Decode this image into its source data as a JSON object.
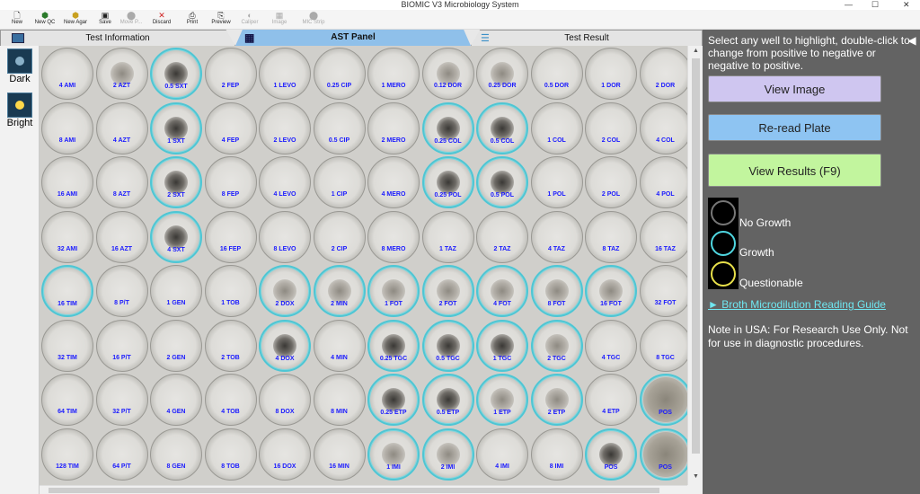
{
  "app": {
    "title": "BIOMIC V3 Microbiology System"
  },
  "window_controls": {
    "minimize": "—",
    "maximize": "☐",
    "close": "✕"
  },
  "toolbar": [
    {
      "label": "New",
      "icon": "new-icon",
      "enabled": true
    },
    {
      "label": "New QC",
      "icon": "new-qc-icon",
      "enabled": true
    },
    {
      "label": "New Agar",
      "icon": "new-agar-icon",
      "enabled": true
    },
    {
      "label": "Save",
      "icon": "save-icon",
      "enabled": true
    },
    {
      "label": "Move P...",
      "icon": "move-icon",
      "enabled": false
    },
    {
      "label": "Discard",
      "icon": "discard-icon",
      "enabled": true
    },
    {
      "label": "Print",
      "icon": "print-icon",
      "enabled": true
    },
    {
      "label": "Preview",
      "icon": "preview-icon",
      "enabled": true
    },
    {
      "label": "Caliper",
      "icon": "caliper-icon",
      "enabled": false
    },
    {
      "label": "Image",
      "icon": "image-icon",
      "enabled": false
    },
    {
      "label": "MIC Strip",
      "icon": "mic-strip-icon",
      "enabled": false
    }
  ],
  "tabs": [
    {
      "label": "Test Information",
      "active": false
    },
    {
      "label": "AST Panel",
      "active": true
    },
    {
      "label": "Test Result",
      "active": false
    }
  ],
  "left_panel": [
    {
      "label": "Dark"
    },
    {
      "label": "Bright"
    }
  ],
  "plate": {
    "rows": [
      [
        "4 AMI",
        "2 AZT",
        "0.5 SXT",
        "2 FEP",
        "1 LEVO",
        "0.25 CIP",
        "1 MERO",
        "0.12 DOR",
        "0.25 DOR",
        "0.5 DOR",
        "1 DOR",
        "2 DOR"
      ],
      [
        "8 AMI",
        "4 AZT",
        "1 SXT",
        "4 FEP",
        "2 LEVO",
        "0.5 CIP",
        "2 MERO",
        "0.25 COL",
        "0.5 COL",
        "1 COL",
        "2 COL",
        "4 COL"
      ],
      [
        "16 AMI",
        "8 AZT",
        "2 SXT",
        "8 FEP",
        "4 LEVO",
        "1 CIP",
        "4 MERO",
        "0.25 POL",
        "0.5 POL",
        "1 POL",
        "2 POL",
        "4 POL"
      ],
      [
        "32 AMI",
        "16 AZT",
        "4 SXT",
        "16 FEP",
        "8 LEVO",
        "2 CIP",
        "8 MERO",
        "1 TAZ",
        "2 TAZ",
        "4 TAZ",
        "8 TAZ",
        "16 TAZ"
      ],
      [
        "16 TIM",
        "8 P/T",
        "1 GEN",
        "1 TOB",
        "2 DOX",
        "2 MIN",
        "1 FOT",
        "2 FOT",
        "4 FOT",
        "8 FOT",
        "16 FOT",
        "32 FOT"
      ],
      [
        "32 TIM",
        "16 P/T",
        "2 GEN",
        "2 TOB",
        "4 DOX",
        "4 MIN",
        "0.25 TGC",
        "0.5 TGC",
        "1 TGC",
        "2 TGC",
        "4 TGC",
        "8 TGC"
      ],
      [
        "64 TIM",
        "32 P/T",
        "4 GEN",
        "4 TOB",
        "8 DOX",
        "8 MIN",
        "0.25 ETP",
        "0.5 ETP",
        "1 ETP",
        "2 ETP",
        "4 ETP",
        "POS"
      ],
      [
        "128 TIM",
        "64 P/T",
        "8 GEN",
        "8 TOB",
        "16 DOX",
        "16 MIN",
        "1 IMI",
        "2 IMI",
        "4 IMI",
        "8 IMI",
        "POS",
        "POS"
      ]
    ],
    "growth": [
      [
        0,
        0,
        1,
        0,
        0,
        0,
        0,
        0,
        0,
        0,
        0,
        0
      ],
      [
        0,
        0,
        1,
        0,
        0,
        0,
        0,
        1,
        1,
        0,
        0,
        0
      ],
      [
        0,
        0,
        1,
        0,
        0,
        0,
        0,
        1,
        1,
        0,
        0,
        0
      ],
      [
        0,
        0,
        1,
        0,
        0,
        0,
        0,
        0,
        0,
        0,
        0,
        0
      ],
      [
        1,
        0,
        0,
        0,
        1,
        1,
        1,
        1,
        1,
        1,
        1,
        0
      ],
      [
        0,
        0,
        0,
        0,
        1,
        0,
        1,
        1,
        1,
        1,
        0,
        0
      ],
      [
        0,
        0,
        0,
        0,
        0,
        0,
        1,
        1,
        1,
        1,
        0,
        1
      ],
      [
        0,
        0,
        0,
        0,
        0,
        0,
        1,
        1,
        0,
        0,
        1,
        1
      ]
    ],
    "pellet": [
      [
        "n",
        "l",
        "d",
        "n",
        "n",
        "n",
        "n",
        "l",
        "l",
        "n",
        "n",
        "n"
      ],
      [
        "n",
        "n",
        "d",
        "n",
        "n",
        "n",
        "n",
        "d",
        "d",
        "n",
        "n",
        "n"
      ],
      [
        "n",
        "n",
        "d",
        "n",
        "n",
        "n",
        "n",
        "d",
        "d",
        "n",
        "n",
        "n"
      ],
      [
        "n",
        "n",
        "d",
        "n",
        "n",
        "n",
        "n",
        "n",
        "n",
        "n",
        "n",
        "n"
      ],
      [
        "n",
        "n",
        "n",
        "n",
        "l",
        "l",
        "l",
        "l",
        "l",
        "l",
        "l",
        "n"
      ],
      [
        "n",
        "n",
        "n",
        "n",
        "d",
        "n",
        "d",
        "d",
        "d",
        "l",
        "n",
        "n"
      ],
      [
        "n",
        "n",
        "n",
        "n",
        "n",
        "n",
        "d",
        "d",
        "l",
        "l",
        "n",
        "h"
      ],
      [
        "n",
        "n",
        "n",
        "n",
        "n",
        "n",
        "l",
        "l",
        "n",
        "n",
        "d",
        "h"
      ]
    ]
  },
  "right_panel": {
    "instructions": "Select any well to highlight, double-click to change from positive to negative or negative to positive.",
    "collapse_icon": "◀",
    "buttons": {
      "view_image": "View Image",
      "reread": "Re-read Plate",
      "view_results": "View Results (F9)"
    },
    "legend": [
      {
        "label": "No Growth",
        "color": "#777777"
      },
      {
        "label": "Growth",
        "color": "#4fd6e0"
      },
      {
        "label": "Questionable",
        "color": "#e8e04a"
      }
    ],
    "guide_link": "► Broth Microdilution Reading Guide",
    "note": "Note in USA: For Research Use Only. Not for use in diagnostic procedures."
  }
}
